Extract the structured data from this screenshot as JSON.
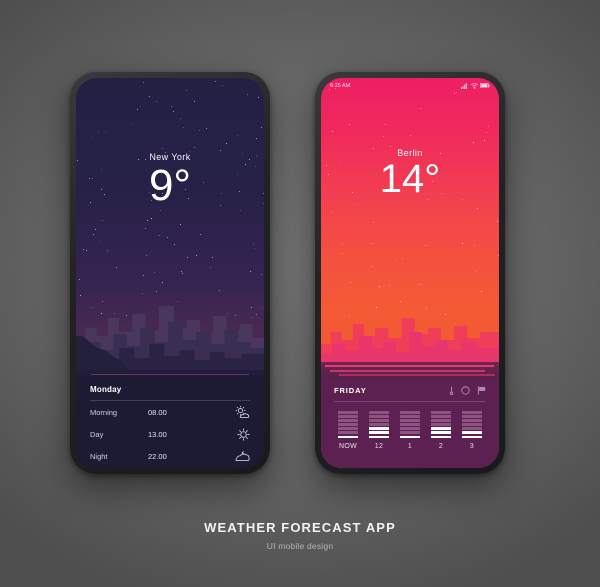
{
  "caption": {
    "title": "WEATHER FORECAST APP",
    "subtitle": "UI mobile design"
  },
  "phone_left": {
    "city": "New York",
    "temperature": "9°",
    "panel": {
      "day_label": "Monday",
      "rows": [
        {
          "label": "Morning",
          "time": "08.00",
          "icon": "sun-behind-cloud-icon"
        },
        {
          "label": "Day",
          "time": "13.00",
          "icon": "sun-icon"
        },
        {
          "label": "Night",
          "time": "22.00",
          "icon": "cloud-night-icon"
        }
      ]
    },
    "theme": {
      "sky_top": "#232044",
      "sky_bottom": "#1d1b36",
      "panel_bg": "#1d1b33",
      "text": "#ffffff"
    }
  },
  "phone_right": {
    "statusbar": {
      "time": "6:25 AM",
      "icons": [
        "signal-icon",
        "wifi-icon",
        "battery-icon"
      ]
    },
    "city": "Berlin",
    "temperature": "14°",
    "panel": {
      "day_label": "FRIDAY",
      "icons": [
        "thermometer-icon",
        "compass-icon",
        "flag-icon"
      ],
      "columns": [
        {
          "label": "NOW",
          "segments": 7,
          "filled": 1
        },
        {
          "label": "12",
          "segments": 7,
          "filled": 3
        },
        {
          "label": "1",
          "segments": 7,
          "filled": 1
        },
        {
          "label": "2",
          "segments": 7,
          "filled": 3
        },
        {
          "label": "3",
          "segments": 7,
          "filled": 2
        }
      ]
    },
    "theme": {
      "sky_top": "#ee1e63",
      "sky_bottom": "#e8512f",
      "panel_bg": "#5c2150",
      "bar_off": "#8e5380",
      "bar_on": "#ffffff",
      "text": "#ffffff"
    }
  },
  "background": {
    "color": "#6b6b6b"
  }
}
